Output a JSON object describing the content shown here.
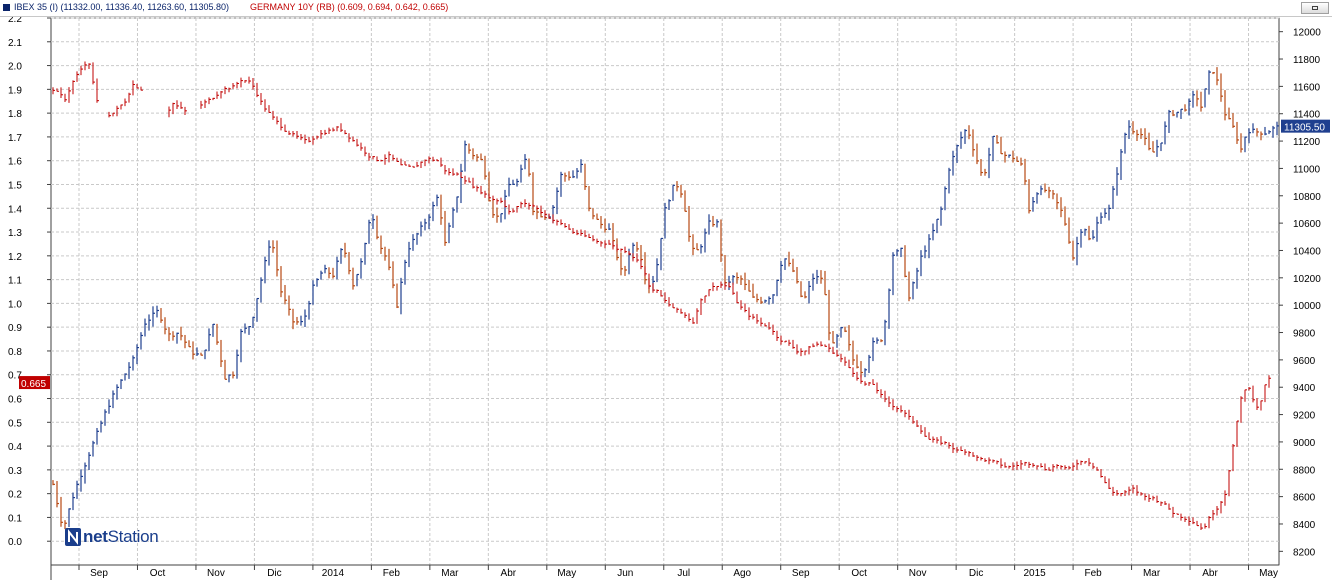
{
  "header": {
    "label_left": "IBEX 35 (I) (11332.00, 11336.40, 11263.60, 11305.80)",
    "label_right": "GERMANY 10Y (RB) (0.609, 0.694, 0.642, 0.665)"
  },
  "logo": {
    "prefix": "net",
    "suffix": "Station"
  },
  "colors": {
    "up": "#1f3f8f",
    "down": "#b84a14",
    "bund": "#c00000",
    "last_ibex_tag": "#1f3f8f",
    "last_bund_tag": "#c00000"
  },
  "chart_data": {
    "type": "ohlc",
    "grid": true,
    "x_labels": [
      "Sep",
      "Oct",
      "Nov",
      "Dic",
      "2014",
      "Feb",
      "Mar",
      "Abr",
      "May",
      "Jun",
      "Jul",
      "Ago",
      "Sep",
      "Oct",
      "Nov",
      "Dic",
      "2015",
      "Feb",
      "Mar",
      "Abr",
      "May"
    ],
    "left_axis": {
      "ticks": [
        "0.0",
        "0.1",
        "0.2",
        "0.3",
        "0.4",
        "0.5",
        "0.6",
        "0.7",
        "0.8",
        "0.9",
        "1.0",
        "1.1",
        "1.2",
        "1.3",
        "1.4",
        "1.5",
        "1.6",
        "1.7",
        "1.8",
        "1.9",
        "2.0",
        "2.1",
        "2.2"
      ],
      "ylim": [
        -0.1,
        2.2
      ],
      "last_tag": "0.665"
    },
    "right_axis": {
      "ticks": [
        "8200",
        "8400",
        "8600",
        "8800",
        "9000",
        "9200",
        "9400",
        "9600",
        "9800",
        "10000",
        "10200",
        "10400",
        "10600",
        "10800",
        "11000",
        "11200",
        "11400",
        "11600",
        "11800",
        "12000"
      ],
      "ylim": [
        8100,
        12100
      ],
      "last_tag": "11305.50"
    },
    "series": [
      {
        "name": "IBEX 35 (I)",
        "axis": "right",
        "points": [
          [
            0,
            8690
          ],
          [
            10,
            8360
          ],
          [
            22,
            8650
          ],
          [
            38,
            8950
          ],
          [
            52,
            9210
          ],
          [
            62,
            9370
          ],
          [
            80,
            9600
          ],
          [
            92,
            9870
          ],
          [
            105,
            9960
          ],
          [
            115,
            9780
          ],
          [
            126,
            9800
          ],
          [
            138,
            9660
          ],
          [
            149,
            9620
          ],
          [
            160,
            9860
          ],
          [
            172,
            9470
          ],
          [
            180,
            9500
          ],
          [
            188,
            9800
          ],
          [
            198,
            9860
          ],
          [
            210,
            10250
          ],
          [
            218,
            10500
          ],
          [
            228,
            10100
          ],
          [
            240,
            9880
          ],
          [
            250,
            9870
          ],
          [
            260,
            10130
          ],
          [
            270,
            10260
          ],
          [
            280,
            10220
          ],
          [
            290,
            10440
          ],
          [
            300,
            10150
          ],
          [
            310,
            10350
          ],
          [
            318,
            10700
          ],
          [
            326,
            10450
          ],
          [
            334,
            10330
          ],
          [
            344,
            10000
          ],
          [
            354,
            10400
          ],
          [
            365,
            10530
          ],
          [
            375,
            10640
          ],
          [
            385,
            10800
          ],
          [
            392,
            10450
          ],
          [
            404,
            10800
          ],
          [
            412,
            11170
          ],
          [
            420,
            11100
          ],
          [
            430,
            11050
          ],
          [
            438,
            10690
          ],
          [
            446,
            10630
          ],
          [
            456,
            10880
          ],
          [
            464,
            10900
          ],
          [
            474,
            11100
          ],
          [
            480,
            10700
          ],
          [
            490,
            10650
          ],
          [
            498,
            10660
          ],
          [
            508,
            10950
          ],
          [
            520,
            10940
          ],
          [
            528,
            11020
          ],
          [
            536,
            10700
          ],
          [
            546,
            10600
          ],
          [
            556,
            10550
          ],
          [
            562,
            10410
          ],
          [
            570,
            10200
          ],
          [
            578,
            10440
          ],
          [
            586,
            10420
          ],
          [
            594,
            10130
          ],
          [
            602,
            10200
          ],
          [
            612,
            10700
          ],
          [
            622,
            10900
          ],
          [
            630,
            10800
          ],
          [
            638,
            10400
          ],
          [
            646,
            10400
          ],
          [
            656,
            10600
          ],
          [
            664,
            10600
          ],
          [
            672,
            10150
          ],
          [
            680,
            10200
          ],
          [
            688,
            10190
          ],
          [
            700,
            10050
          ],
          [
            710,
            10030
          ],
          [
            720,
            10080
          ],
          [
            730,
            10360
          ],
          [
            740,
            10250
          ],
          [
            750,
            10020
          ],
          [
            760,
            10200
          ],
          [
            770,
            10200
          ],
          [
            778,
            9680
          ],
          [
            790,
            9850
          ],
          [
            800,
            9600
          ],
          [
            810,
            9500
          ],
          [
            820,
            9720
          ],
          [
            830,
            9760
          ],
          [
            840,
            10370
          ],
          [
            848,
            10400
          ],
          [
            856,
            10050
          ],
          [
            868,
            10350
          ],
          [
            878,
            10500
          ],
          [
            888,
            10700
          ],
          [
            896,
            11000
          ],
          [
            906,
            11200
          ],
          [
            914,
            11300
          ],
          [
            920,
            11150
          ],
          [
            930,
            10920
          ],
          [
            940,
            11220
          ],
          [
            950,
            11100
          ],
          [
            960,
            11080
          ],
          [
            970,
            11010
          ],
          [
            976,
            10700
          ],
          [
            984,
            10830
          ],
          [
            992,
            10840
          ],
          [
            1000,
            10800
          ],
          [
            1010,
            10660
          ],
          [
            1020,
            10350
          ],
          [
            1030,
            10600
          ],
          [
            1038,
            10440
          ],
          [
            1046,
            10650
          ],
          [
            1056,
            10700
          ],
          [
            1066,
            11040
          ],
          [
            1074,
            11320
          ],
          [
            1080,
            11280
          ],
          [
            1090,
            11240
          ],
          [
            1098,
            11100
          ],
          [
            1108,
            11200
          ],
          [
            1116,
            11400
          ],
          [
            1124,
            11410
          ],
          [
            1134,
            11450
          ],
          [
            1142,
            11550
          ],
          [
            1148,
            11450
          ],
          [
            1158,
            11750
          ],
          [
            1166,
            11600
          ],
          [
            1172,
            11400
          ],
          [
            1180,
            11300
          ],
          [
            1188,
            11140
          ],
          [
            1194,
            11280
          ],
          [
            1202,
            11270
          ],
          [
            1212,
            11260
          ],
          [
            1220,
            11290
          ],
          [
            1226,
            11306
          ]
        ]
      },
      {
        "name": "GERMANY 10Y (RB)",
        "axis": "left",
        "points": [
          [
            0,
            1.9
          ],
          [
            12,
            1.86
          ],
          [
            22,
            1.95
          ],
          [
            35,
            2.02
          ],
          [
            48,
            1.78
          ],
          [
            60,
            1.8
          ],
          [
            72,
            1.85
          ],
          [
            80,
            1.92
          ],
          [
            88,
            1.9
          ],
          [
            100,
            1.83
          ],
          [
            110,
            1.78
          ],
          [
            120,
            1.84
          ],
          [
            135,
            1.8
          ],
          [
            150,
            1.84
          ],
          [
            158,
            1.86
          ],
          [
            170,
            1.9
          ],
          [
            180,
            1.91
          ],
          [
            188,
            1.94
          ],
          [
            198,
            1.93
          ],
          [
            210,
            1.83
          ],
          [
            220,
            1.78
          ],
          [
            234,
            1.72
          ],
          [
            244,
            1.7
          ],
          [
            254,
            1.68
          ],
          [
            262,
            1.7
          ],
          [
            272,
            1.72
          ],
          [
            286,
            1.74
          ],
          [
            296,
            1.7
          ],
          [
            306,
            1.66
          ],
          [
            316,
            1.62
          ],
          [
            326,
            1.6
          ],
          [
            336,
            1.62
          ],
          [
            348,
            1.58
          ],
          [
            360,
            1.57
          ],
          [
            374,
            1.61
          ],
          [
            384,
            1.6
          ],
          [
            394,
            1.55
          ],
          [
            406,
            1.54
          ],
          [
            418,
            1.5
          ],
          [
            428,
            1.47
          ],
          [
            438,
            1.44
          ],
          [
            448,
            1.43
          ],
          [
            458,
            1.38
          ],
          [
            468,
            1.42
          ],
          [
            480,
            1.41
          ],
          [
            490,
            1.38
          ],
          [
            500,
            1.35
          ],
          [
            510,
            1.33
          ],
          [
            520,
            1.3
          ],
          [
            534,
            1.28
          ],
          [
            544,
            1.26
          ],
          [
            556,
            1.25
          ],
          [
            564,
            1.23
          ],
          [
            574,
            1.22
          ],
          [
            584,
            1.18
          ],
          [
            590,
            1.15
          ],
          [
            596,
            1.07
          ],
          [
            604,
            1.05
          ],
          [
            614,
            1.0
          ],
          [
            624,
            0.97
          ],
          [
            632,
            0.95
          ],
          [
            640,
            0.92
          ],
          [
            646,
            1.0
          ],
          [
            656,
            1.06
          ],
          [
            666,
            1.08
          ],
          [
            676,
            1.07
          ],
          [
            686,
            0.99
          ],
          [
            696,
            0.95
          ],
          [
            706,
            0.92
          ],
          [
            716,
            0.9
          ],
          [
            726,
            0.85
          ],
          [
            736,
            0.83
          ],
          [
            744,
            0.8
          ],
          [
            752,
            0.8
          ],
          [
            762,
            0.83
          ],
          [
            772,
            0.82
          ],
          [
            782,
            0.79
          ],
          [
            792,
            0.75
          ],
          [
            800,
            0.71
          ],
          [
            810,
            0.66
          ],
          [
            820,
            0.66
          ],
          [
            830,
            0.6
          ],
          [
            840,
            0.57
          ],
          [
            848,
            0.55
          ],
          [
            856,
            0.52
          ],
          [
            866,
            0.48
          ],
          [
            874,
            0.43
          ],
          [
            884,
            0.42
          ],
          [
            894,
            0.41
          ],
          [
            904,
            0.38
          ],
          [
            914,
            0.38
          ],
          [
            924,
            0.35
          ],
          [
            934,
            0.34
          ],
          [
            944,
            0.33
          ],
          [
            954,
            0.31
          ],
          [
            964,
            0.32
          ],
          [
            974,
            0.33
          ],
          [
            984,
            0.32
          ],
          [
            994,
            0.3
          ],
          [
            1004,
            0.32
          ],
          [
            1014,
            0.3
          ],
          [
            1024,
            0.33
          ],
          [
            1034,
            0.34
          ],
          [
            1044,
            0.3
          ],
          [
            1054,
            0.23
          ],
          [
            1062,
            0.2
          ],
          [
            1070,
            0.2
          ],
          [
            1080,
            0.22
          ],
          [
            1090,
            0.19
          ],
          [
            1100,
            0.18
          ],
          [
            1110,
            0.16
          ],
          [
            1120,
            0.12
          ],
          [
            1130,
            0.1
          ],
          [
            1140,
            0.08
          ],
          [
            1150,
            0.05
          ],
          [
            1158,
            0.11
          ],
          [
            1166,
            0.15
          ],
          [
            1172,
            0.2
          ],
          [
            1180,
            0.4
          ],
          [
            1188,
            0.6
          ],
          [
            1194,
            0.66
          ],
          [
            1200,
            0.6
          ],
          [
            1206,
            0.55
          ],
          [
            1212,
            0.66
          ],
          [
            1216,
            0.68
          ]
        ]
      }
    ]
  }
}
